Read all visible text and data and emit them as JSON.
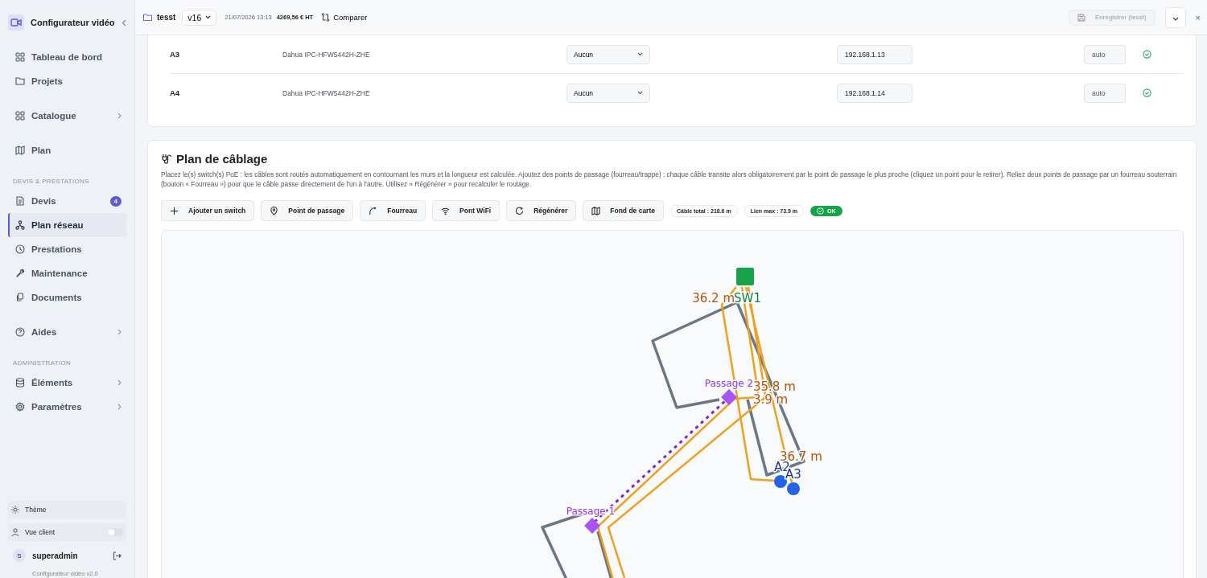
{
  "sidebar": {
    "title": "Configurateur vidéo",
    "groups": [
      {
        "items": [
          {
            "label": "Tableau de bord",
            "selected": false,
            "submenu": false
          },
          {
            "label": "Projets",
            "selected": false,
            "submenu": false
          }
        ]
      },
      {
        "items": [
          {
            "label": "Catalogue",
            "selected": false,
            "submenu": true
          }
        ]
      },
      {
        "items": [
          {
            "label": "Plan",
            "selected": false,
            "submenu": false
          }
        ]
      },
      {
        "heading": "DEVIS & PRESTATIONS",
        "items": [
          {
            "label": "Devis",
            "selected": false,
            "submenu": false,
            "badge": "4"
          },
          {
            "label": "Plan réseau",
            "selected": true,
            "submenu": false
          },
          {
            "label": "Prestations",
            "selected": false,
            "submenu": false
          },
          {
            "label": "Maintenance",
            "selected": false,
            "submenu": false
          },
          {
            "label": "Documents",
            "selected": false,
            "submenu": false
          }
        ]
      },
      {
        "items": [
          {
            "label": "Aides",
            "selected": false,
            "submenu": true
          }
        ]
      },
      {
        "heading": "ADMINISTRATION",
        "items": [
          {
            "label": "Éléments",
            "selected": false,
            "submenu": true
          },
          {
            "label": "Paramètres",
            "selected": false,
            "submenu": true
          }
        ]
      }
    ],
    "theme_label": "Thème",
    "client_view": {
      "label": "Vue client",
      "on": false
    },
    "user": {
      "initial": "S",
      "name": "superadmin"
    },
    "footer": "Configurateur vidéo v2.0"
  },
  "header": {
    "project": "tesst",
    "version": "v16",
    "date": "21/07/2026 13:13",
    "total": "4269,56 € HT",
    "compare": "Comparer",
    "save": {
      "label": "Enregistrer (tesst)",
      "disabled": true
    },
    "close": "×"
  },
  "table": {
    "rows": [
      {
        "name": "A3",
        "model": "Dahua IPC-HFW5442H-ZHE",
        "switch": "Aucun",
        "ip": "192.168.1.13",
        "port": "auto",
        "ok": true
      },
      {
        "name": "A4",
        "model": "Dahua IPC-HFW5442H-ZHE",
        "switch": "Aucun",
        "ip": "192.168.1.14",
        "port": "auto",
        "ok": true
      }
    ]
  },
  "plan": {
    "title": "Plan de câblage",
    "description": "Placez le(s) switch(s) PoE : les câbles sont routés automatiquement en contournant les murs et la longueur est calculée. Ajoutez des points de passage (fourreau/trappe) : chaque câble transite alors obligatoirement par le point de passage le plus proche (cliquez un point pour le retirer). Reliez deux points de passage par un fourreau souterrain (bouton « Fourreau ») pour que le câble passe directement de l'un à l'autre. Utilisez « Régénérer » pour recalculer le routage.",
    "tools": [
      "Ajouter un switch",
      "Point de passage",
      "Fourreau",
      "Pont WiFi",
      "Régénérer",
      "Fond de carte"
    ],
    "stats": [
      "Câble total : 218.6 m",
      "Lien max : 73.9 m"
    ],
    "status": {
      "label": "OK",
      "ok": true
    },
    "nodes": [
      {
        "kind": "switch",
        "label": "SW1"
      },
      {
        "kind": "passage",
        "label": "Passage 2"
      },
      {
        "kind": "passage",
        "label": "Passage 1"
      },
      {
        "kind": "camera",
        "label": "A2"
      },
      {
        "kind": "camera",
        "label": "A3"
      }
    ],
    "cable_lengths": [
      "36.2 m",
      "35.8 m",
      "3.9 m",
      "36.7 m"
    ]
  }
}
